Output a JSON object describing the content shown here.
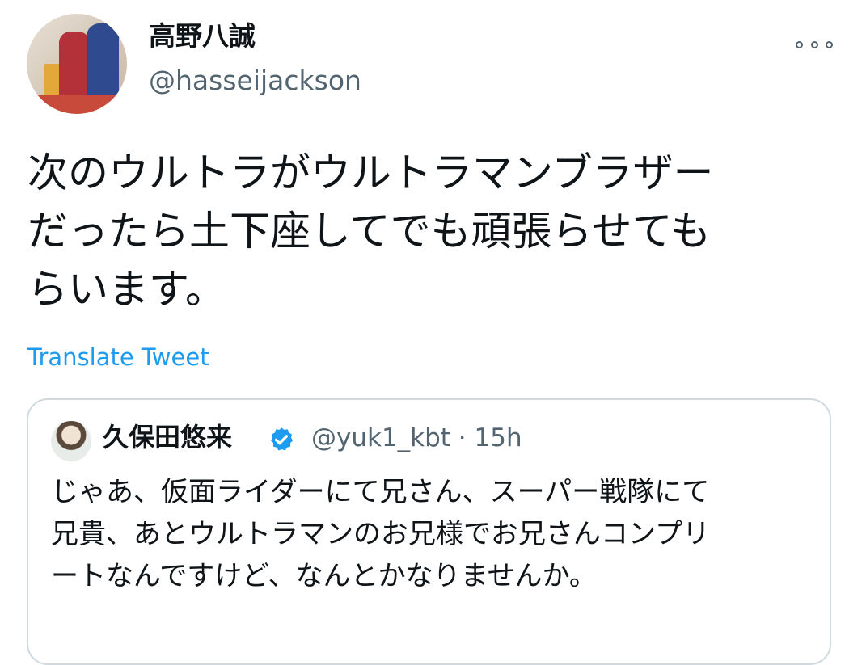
{
  "tweet": {
    "author": {
      "name": "高野八誠",
      "handle": "@hasseijackson"
    },
    "text": "次のウルトラがウルトラマンブラザー\nだったら土下座してでも頑張らせても\nらいます。",
    "translate_label": "Translate Tweet"
  },
  "quoted_tweet": {
    "author": {
      "name": "久保田悠来",
      "handle": "@yuk1_kbt · 15h"
    },
    "text": "じゃあ、仮面ライダーにて兄さん、スーパー戦隊にて\n兄貴、あとウルトラマンのお兄様でお兄さんコンプリ\nートなんですけど、なんとかなりませんか。"
  },
  "colors": {
    "link": "#1d9bf0",
    "verified": "#1d9bf0",
    "secondary_text": "#536471",
    "border": "#cfd9de"
  },
  "icons": [
    "more-options-icon",
    "verified-badge-icon"
  ]
}
